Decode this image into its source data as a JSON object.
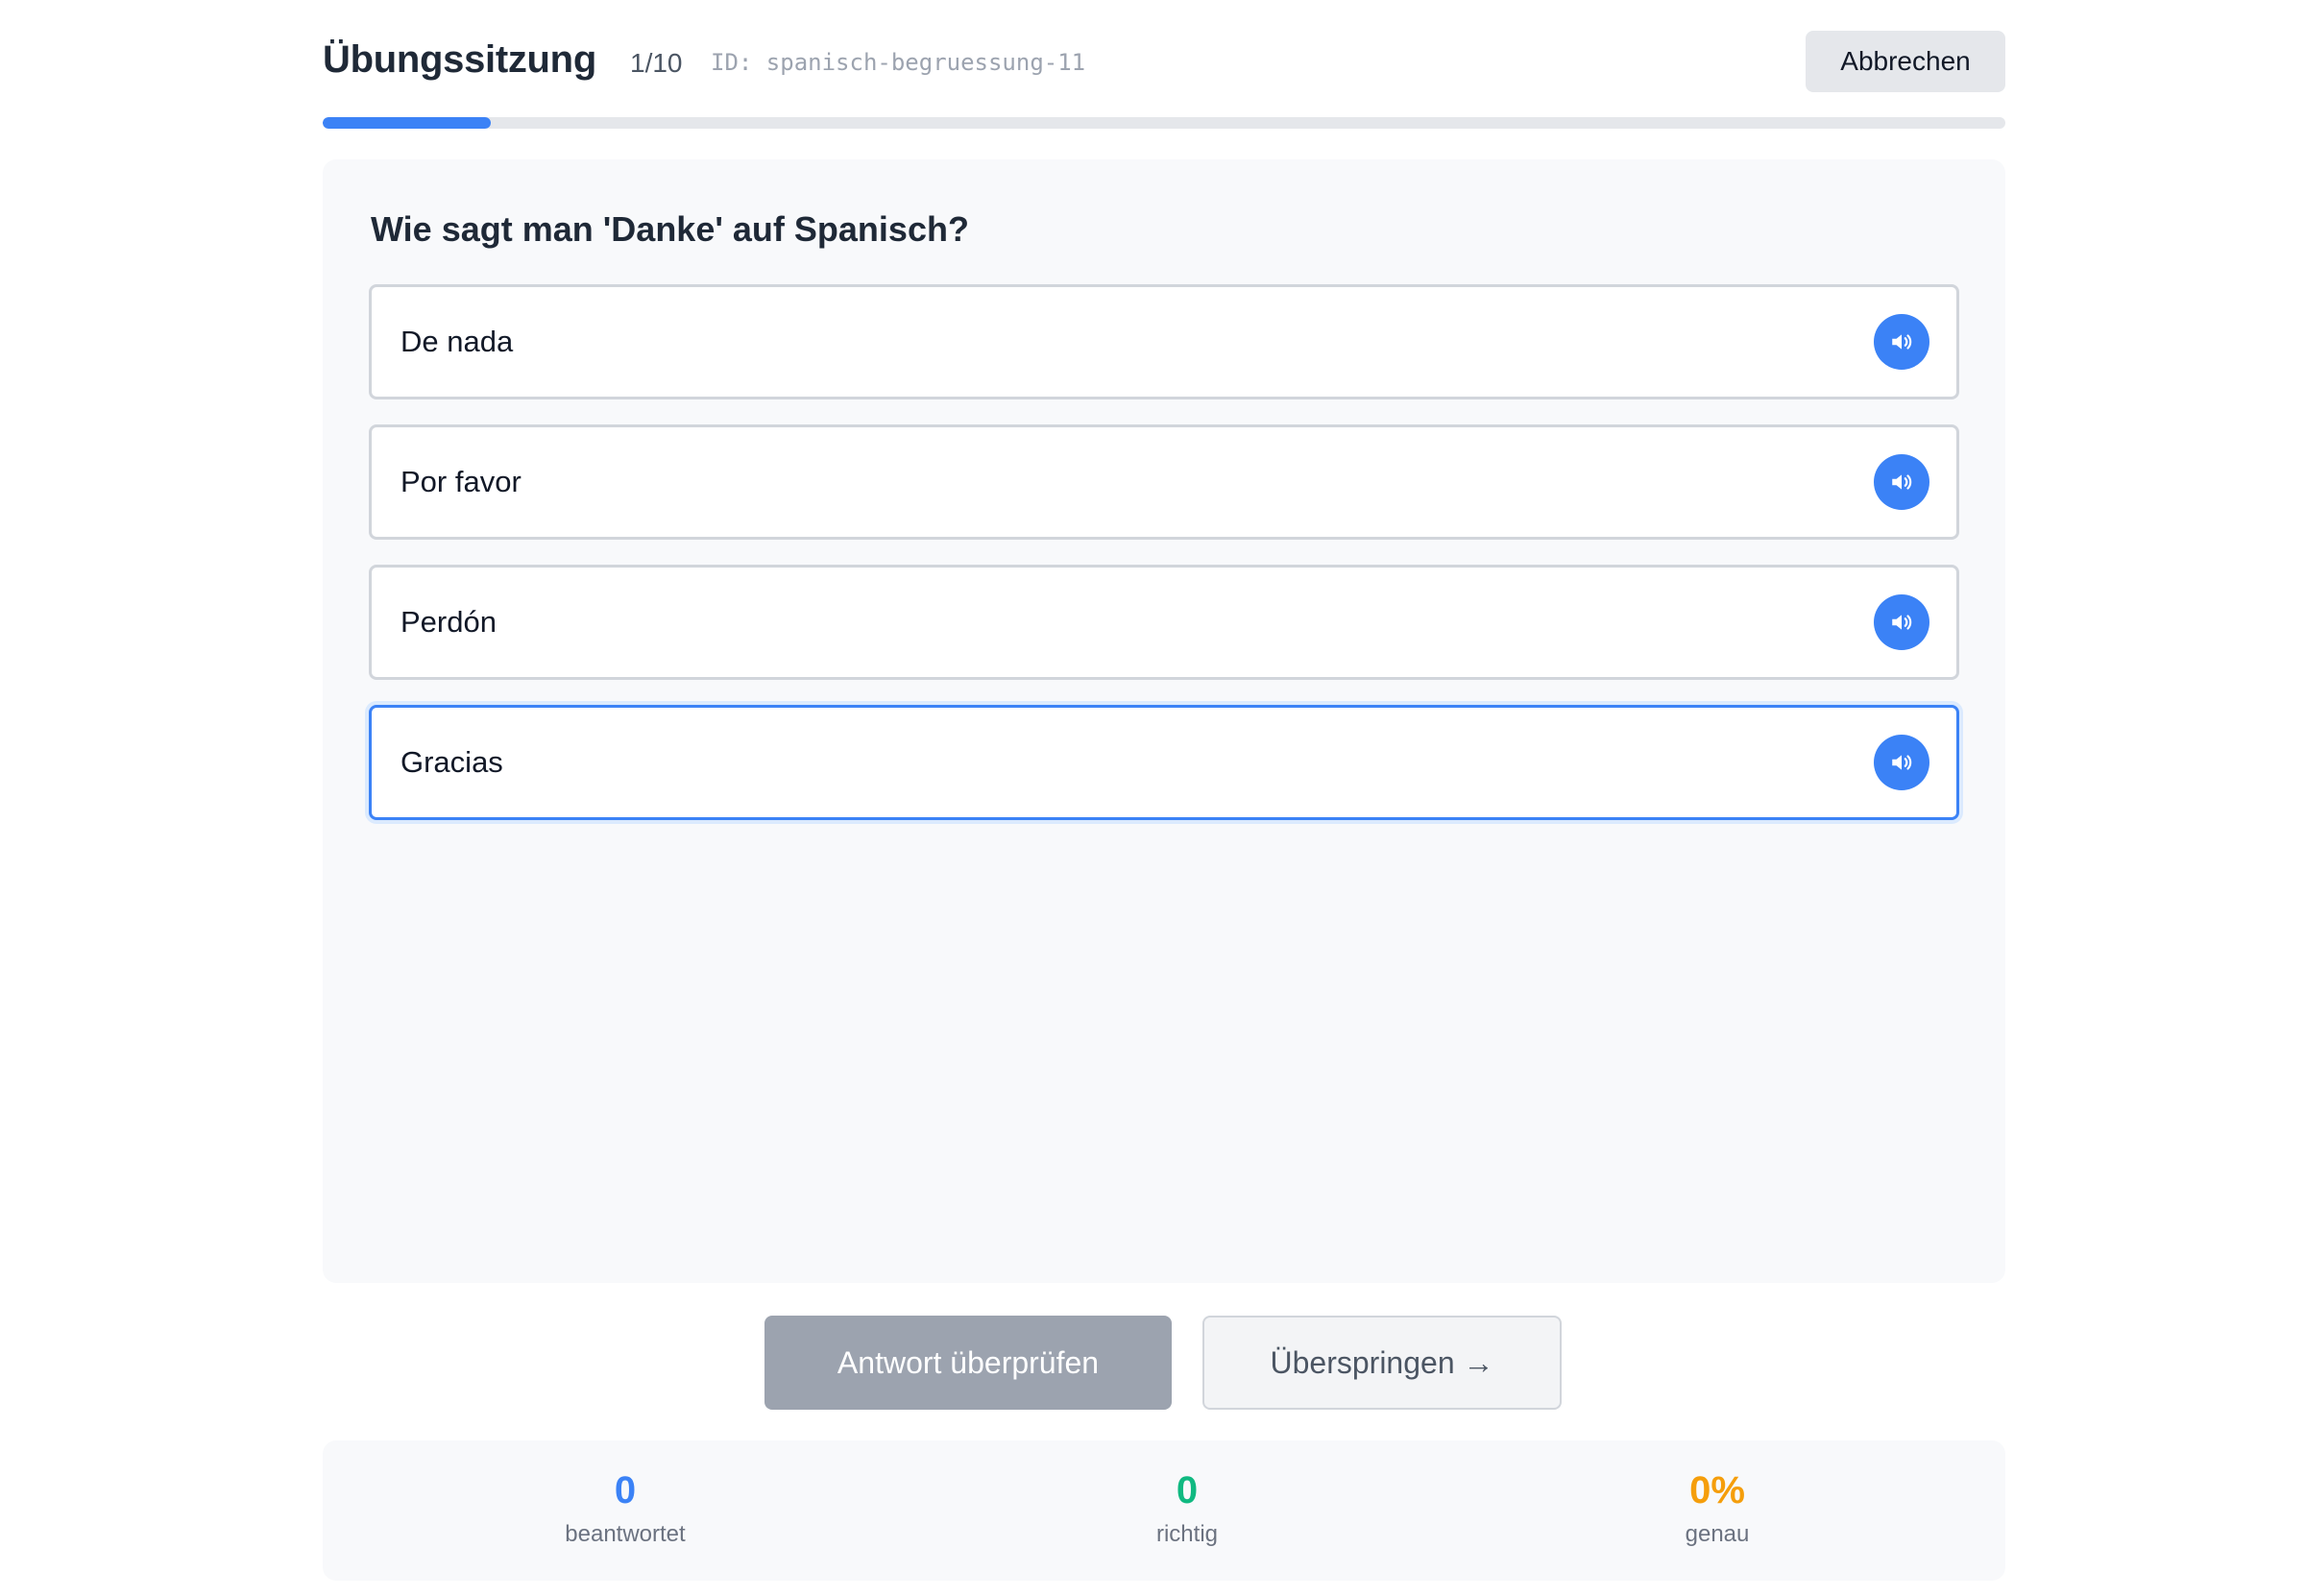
{
  "header": {
    "title": "Übungssitzung",
    "counter": "1/10",
    "session_id": "ID: spanisch-begruessung-11",
    "cancel_label": "Abbrechen"
  },
  "progress": {
    "fraction": 0.1,
    "color": "#3b82f6"
  },
  "question": {
    "text": "Wie sagt man 'Danke' auf Spanisch?",
    "options": [
      {
        "label": "De nada",
        "selected": false,
        "icon": "speaker-icon"
      },
      {
        "label": "Por favor",
        "selected": false,
        "icon": "speaker-icon"
      },
      {
        "label": "Perdón",
        "selected": false,
        "icon": "speaker-icon"
      },
      {
        "label": "Gracias",
        "selected": true,
        "icon": "speaker-icon"
      }
    ]
  },
  "actions": {
    "check_label": "Antwort überprüfen",
    "skip_label": "Überspringen →"
  },
  "stats": {
    "answered": {
      "value": "0",
      "label": "beantwortet",
      "color": "#3b82f6"
    },
    "correct": {
      "value": "0",
      "label": "richtig",
      "color": "#10b981"
    },
    "accuracy": {
      "value": "0%",
      "label": "genau",
      "color": "#f59e0b"
    }
  }
}
